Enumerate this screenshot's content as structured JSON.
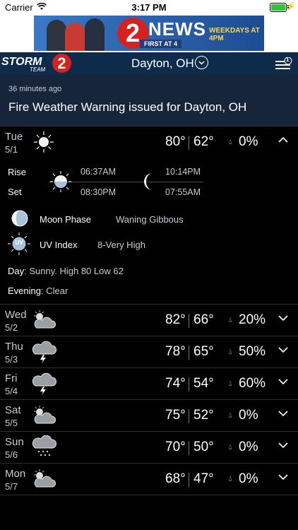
{
  "status_bar": {
    "carrier": "Carrier",
    "time": "3:17 PM"
  },
  "ad": {
    "logo_number": "2",
    "logo_text": "NEWS",
    "tagline": "FIRST AT 4",
    "schedule": "WEEKDAYS AT 4PM"
  },
  "header": {
    "brand_storm": "STORM",
    "brand_team": "TEAM",
    "brand_number": "2",
    "location": "Dayton, OH",
    "notification_count": "1"
  },
  "alert": {
    "age": "36 minutes ago",
    "title": "Fire Weather Warning issued for Dayton, OH"
  },
  "expanded_day": {
    "day": "Tue",
    "date": "5/1",
    "hi": "80°",
    "lo": "62°",
    "precip": "0%",
    "icon": "sunny-icon",
    "rise_label": "Rise",
    "set_label": "Set",
    "sunrise": "06:37AM",
    "sunset": "08:30PM",
    "moonrise": "10:14PM",
    "moonset": "07:55AM",
    "moon_phase_label": "Moon Phase",
    "moon_phase_value": "Waning Gibbous",
    "uv_label": "UV Index",
    "uv_value": "8-Very High",
    "uv_badge": "UV",
    "day_label": "Day",
    "day_text": ": Sunny.  High 80 Low 62",
    "evening_label": "Evening",
    "evening_text": ": Clear"
  },
  "days": [
    {
      "day": "Wed",
      "date": "5/2",
      "hi": "82°",
      "lo": "66°",
      "precip": "20%",
      "icon": "partly-cloudy-icon"
    },
    {
      "day": "Thu",
      "date": "5/3",
      "hi": "78°",
      "lo": "65°",
      "precip": "50%",
      "icon": "thunderstorm-icon"
    },
    {
      "day": "Fri",
      "date": "5/4",
      "hi": "74°",
      "lo": "54°",
      "precip": "60%",
      "icon": "thunderstorm-icon"
    },
    {
      "day": "Sat",
      "date": "5/5",
      "hi": "75°",
      "lo": "52°",
      "precip": "0%",
      "icon": "partly-cloudy-icon"
    },
    {
      "day": "Sun",
      "date": "5/6",
      "hi": "70°",
      "lo": "50°",
      "precip": "0%",
      "icon": "rain-icon"
    },
    {
      "day": "Mon",
      "date": "5/7",
      "hi": "68°",
      "lo": "47°",
      "precip": "0%",
      "icon": "partly-cloudy-icon"
    }
  ],
  "colors": {
    "header_bg": "#0f2b4c",
    "alert_bg": "#16253a",
    "brand_red": "#d7211f"
  }
}
